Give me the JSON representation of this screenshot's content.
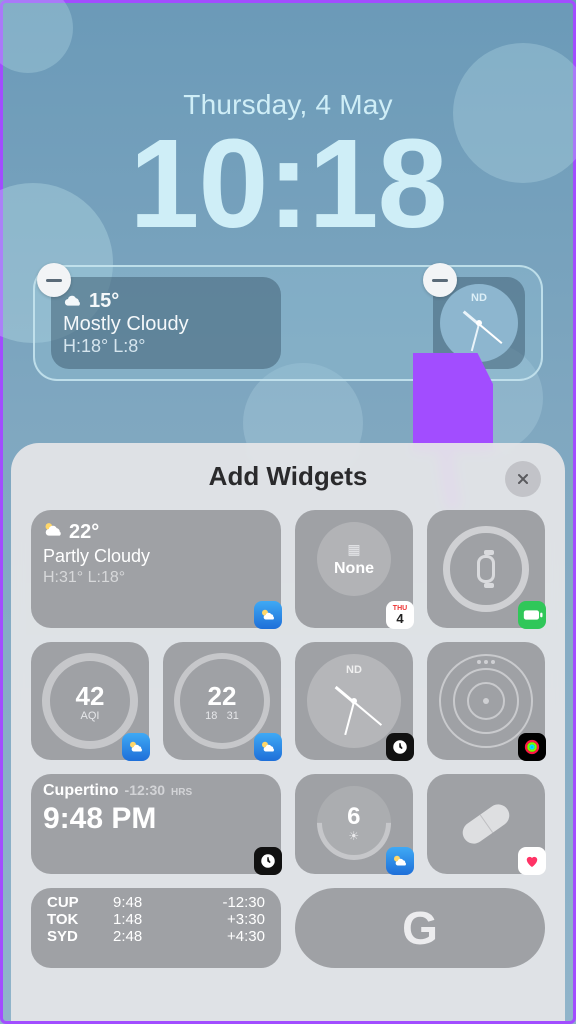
{
  "lockscreen": {
    "date": "Thursday, 4 May",
    "time": "10:18",
    "tray": {
      "weather": {
        "temp": "15°",
        "condition": "Mostly Cloudy",
        "hi_lo": "H:18° L:8°"
      },
      "clock": {
        "label": "ND"
      }
    }
  },
  "sheet": {
    "title": "Add Widgets",
    "calendar_badge": {
      "dow": "THU",
      "day": "4"
    },
    "widgets": {
      "weather_large": {
        "temp": "22°",
        "condition": "Partly Cloudy",
        "hi_lo": "H:31° L:18°"
      },
      "none": {
        "label": "None"
      },
      "aqi": {
        "value": "42",
        "label": "AQI"
      },
      "temp_gauge": {
        "value": "22",
        "low": "18",
        "high": "31"
      },
      "clock": {
        "label": "ND"
      },
      "city_clock": {
        "city": "Cupertino",
        "offset": "-12:30",
        "hrs": "HRS",
        "time": "9:48 PM"
      },
      "uv": {
        "value": "6"
      },
      "tz": {
        "rows": [
          {
            "c": "CUP",
            "t": "9:48",
            "o": "-12:30"
          },
          {
            "c": "TOK",
            "t": "1:48",
            "o": "+3:30"
          },
          {
            "c": "SYD",
            "t": "2:48",
            "o": "+4:30"
          }
        ]
      },
      "google": {
        "g": "G"
      }
    }
  },
  "colors": {
    "accent": "#a24dff"
  }
}
